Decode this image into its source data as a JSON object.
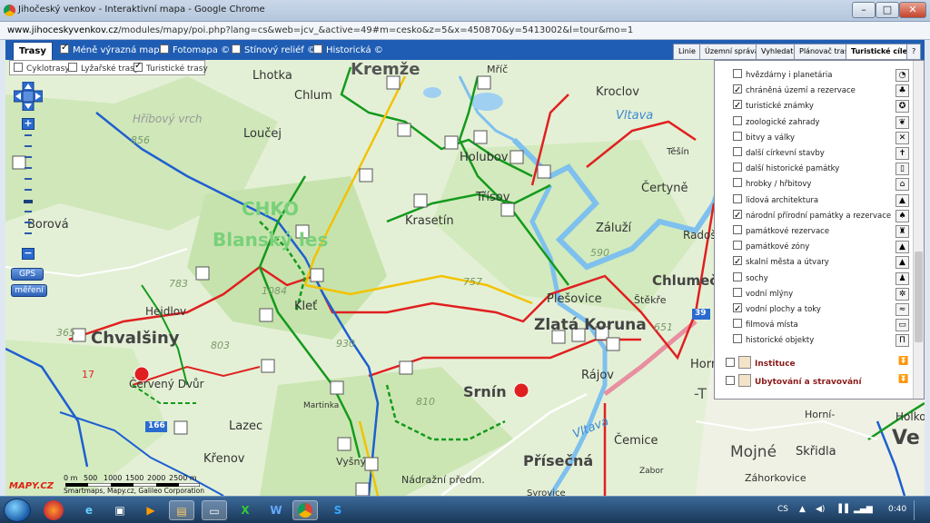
{
  "window": {
    "title": "Jihočeský venkov - Interaktivní mapa - Google Chrome",
    "controls": [
      "–",
      "□",
      "✕"
    ]
  },
  "address": {
    "host": "www.jihoceskyvenkov.cz",
    "path": "/modules/mapy/poi.php?lang=cs&web=jcv_&active=49#m=cesko&z=5&x=450870&y=5413002&l=tour&mo=1"
  },
  "toolbar": {
    "active_tab": "Trasy",
    "layers": [
      {
        "label": "Méně výrazná mapa",
        "checked": true
      },
      {
        "label": "Fotomapa ©",
        "checked": false
      },
      {
        "label": "Stínový reliéf ©",
        "checked": false
      },
      {
        "label": "Historická ©",
        "checked": false
      }
    ],
    "right_tabs": [
      {
        "label": "Linie",
        "active": false
      },
      {
        "label": "Územní správa",
        "active": false
      },
      {
        "label": "Vyhledat",
        "active": false
      },
      {
        "label": "Plánovač tras",
        "active": false
      },
      {
        "label": "Turistické cíle",
        "active": true
      },
      {
        "label": "?",
        "active": false
      }
    ]
  },
  "trasy_sub": [
    {
      "label": "Cyklotrasy",
      "checked": false
    },
    {
      "label": "Lyžařské trasy",
      "checked": false
    },
    {
      "label": "Turistické trasy",
      "checked": true
    }
  ],
  "poi_panel": {
    "items": [
      {
        "label": "hvězdárny i planetária",
        "checked": false,
        "icon": "telescope"
      },
      {
        "label": "chráněná území a rezervace",
        "checked": true,
        "icon": "tree"
      },
      {
        "label": "turistické známky",
        "checked": true,
        "icon": "stamp"
      },
      {
        "label": "zoologické zahrady",
        "checked": false,
        "icon": "paw"
      },
      {
        "label": "bitvy a války",
        "checked": false,
        "icon": "swords"
      },
      {
        "label": "další církevní stavby",
        "checked": false,
        "icon": "cross"
      },
      {
        "label": "další historické památky",
        "checked": false,
        "icon": "scroll"
      },
      {
        "label": "hrobky / hřbitovy",
        "checked": false,
        "icon": "tomb"
      },
      {
        "label": "lidová architektura",
        "checked": false,
        "icon": "house"
      },
      {
        "label": "národní přírodní památky a rezervace",
        "checked": true,
        "icon": "leaf"
      },
      {
        "label": "památkové rezervace",
        "checked": false,
        "icon": "castle"
      },
      {
        "label": "památkové zóny",
        "checked": false,
        "icon": "monument"
      },
      {
        "label": "skalní města a útvary",
        "checked": true,
        "icon": "rock"
      },
      {
        "label": "sochy",
        "checked": false,
        "icon": "statue"
      },
      {
        "label": "vodní mlýny",
        "checked": false,
        "icon": "mill"
      },
      {
        "label": "vodní plochy a toky",
        "checked": true,
        "icon": "water"
      },
      {
        "label": "filmová místa",
        "checked": false,
        "icon": "film"
      },
      {
        "label": "historické objekty",
        "checked": false,
        "icon": "column"
      }
    ],
    "sections": [
      "Instituce",
      "Ubytování a stravování"
    ]
  },
  "map_controls": {
    "gps": "GPS",
    "measure": "měření",
    "zoom_in": "+",
    "zoom_out": "−"
  },
  "places": [
    {
      "name": "Kremže",
      "size": "l"
    },
    {
      "name": "Lhotka",
      "size": "m"
    },
    {
      "name": "Chlum",
      "size": "m"
    },
    {
      "name": "Loučej",
      "size": "m"
    },
    {
      "name": "Kroclov",
      "size": "m"
    },
    {
      "name": "Holubov",
      "size": "m"
    },
    {
      "name": "Třísov",
      "size": "m"
    },
    {
      "name": "Krasetín",
      "size": "m"
    },
    {
      "name": "Čertyně",
      "size": "m"
    },
    {
      "name": "Záluží",
      "size": "m"
    },
    {
      "name": "Borová",
      "size": "m"
    },
    {
      "name": "Hejdlov",
      "size": "m"
    },
    {
      "name": "Chvalšiny",
      "size": "l"
    },
    {
      "name": "Kleť",
      "size": "m"
    },
    {
      "name": "Plešovice",
      "size": "m"
    },
    {
      "name": "Zlatá Koruna",
      "size": "l"
    },
    {
      "name": "Chlumeček",
      "size": "l"
    },
    {
      "name": "Štěkře",
      "size": "s"
    },
    {
      "name": "Rájov",
      "size": "m"
    },
    {
      "name": "Červený Dvůr",
      "size": "m"
    },
    {
      "name": "Lazec",
      "size": "m"
    },
    {
      "name": "Martinka",
      "size": "s"
    },
    {
      "name": "Srnín",
      "size": "l"
    },
    {
      "name": "Křenov",
      "size": "m"
    },
    {
      "name": "Vyšný",
      "size": "s"
    },
    {
      "name": "Přísečná",
      "size": "l"
    },
    {
      "name": "Nádražní předm.",
      "size": "s"
    },
    {
      "name": "Čemice",
      "size": "m"
    },
    {
      "name": "Mojné",
      "size": "l"
    },
    {
      "name": "Skřidla",
      "size": "m"
    },
    {
      "name": "Záhorkovice",
      "size": "s"
    },
    {
      "name": "Horní-",
      "size": "s"
    },
    {
      "name": "Holko",
      "size": "s"
    },
    {
      "name": "Ve",
      "size": "xl"
    },
    {
      "name": "Hříbový vrch",
      "size": "s"
    },
    {
      "name": "Radoš",
      "size": "s"
    },
    {
      "name": "Těšín",
      "size": "s"
    },
    {
      "name": "Mříč",
      "size": "s"
    },
    {
      "name": "Syrovice",
      "size": "s"
    },
    {
      "name": "Horní",
      "size": "s"
    },
    {
      "name": "-T",
      "size": "l"
    },
    {
      "name": "Vltava",
      "size": "river"
    },
    {
      "name": "Vltava",
      "size": "river"
    },
    {
      "name": "Zabor",
      "size": "s"
    }
  ],
  "protected_area": {
    "line1": "CHKO",
    "line2": "Blanský les"
  },
  "elevations": [
    "856",
    "590",
    "783",
    "803",
    "930",
    "757",
    "810",
    "651",
    "365",
    "17",
    "1084"
  ],
  "road_shields": [
    "39",
    "166"
  ],
  "scale": {
    "labels": [
      "0 m",
      "500",
      "1000",
      "1500",
      "2000",
      "2500 m"
    ]
  },
  "attribution": "Smartmaps, Mapy.cz, Galileo Corporation",
  "logo": "MAPY.CZ",
  "taskbar": {
    "lang": "CS",
    "time": "0:40",
    "apps": [
      "firefox",
      "ie",
      "save",
      "media",
      "folder",
      "excel",
      "word",
      "chrome",
      "skype"
    ]
  },
  "colors": {
    "topbar": "#1f5db4",
    "red_route": "#e02020",
    "blue_route": "#1e5fd0",
    "green_route": "#149a1c",
    "yellow_route": "#f2c200",
    "river": "#7ec0ee",
    "chko_text": "#7ad07a"
  }
}
